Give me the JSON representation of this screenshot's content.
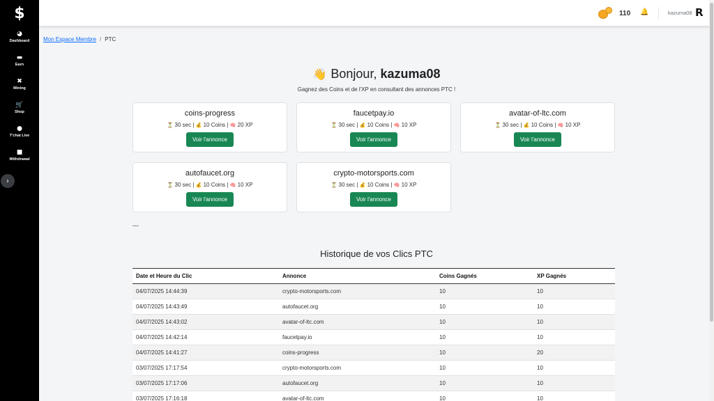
{
  "sidebar": {
    "brand_icon": "dollar-icon",
    "items": [
      {
        "label": "Dashboard",
        "icon": "dashboard-icon",
        "glyph": "◕"
      },
      {
        "label": "Earn",
        "icon": "money-icon",
        "glyph": "▬"
      },
      {
        "label": "Mining",
        "icon": "tools-icon",
        "glyph": "✖"
      },
      {
        "label": "Shop",
        "icon": "cart-icon",
        "glyph": "🛒"
      },
      {
        "label": "T'chat Live",
        "icon": "chat-icon",
        "glyph": "●"
      },
      {
        "label": "Withdrawal",
        "icon": "wallet-icon",
        "glyph": "■"
      }
    ],
    "toggle_icon": "chevron-right-icon"
  },
  "topbar": {
    "coin_count": "110",
    "username": "kazuma08",
    "logo_letter": "R"
  },
  "breadcrumb": {
    "home": "Mon Espace Membre",
    "separator": "/",
    "current": "PTC"
  },
  "greeting": {
    "hello": "Bonjour,",
    "user": "kazuma08",
    "subtitle": "Gagnez des Coins et de l'XP en consultant des annonces PTC !"
  },
  "ads": [
    {
      "title": "coins-progress",
      "time": "30 sec",
      "coins": "10 Coins",
      "xp": "20 XP",
      "button": "Voir l'annonce"
    },
    {
      "title": "faucetpay.io",
      "time": "30 sec",
      "coins": "10 Coins",
      "xp": "10 XP",
      "button": "Voir l'annonce"
    },
    {
      "title": "avatar-of-ltc.com",
      "time": "30 sec",
      "coins": "10 Coins",
      "xp": "10 XP",
      "button": "Voir l'annonce"
    },
    {
      "title": "autofaucet.org",
      "time": "30 sec",
      "coins": "10 Coins",
      "xp": "10 XP",
      "button": "Voir l'annonce"
    },
    {
      "title": "crypto-motorsports.com",
      "time": "30 sec",
      "coins": "10 Coins",
      "xp": "10 XP",
      "button": "Voir l'annonce"
    }
  ],
  "separator_text": "---",
  "history": {
    "title": "Historique de vos Clics PTC",
    "columns": [
      "Date et Heure du Clic",
      "Annonce",
      "Coins Gagnés",
      "XP Gagnés"
    ],
    "rows": [
      [
        "04/07/2025 14:44:39",
        "crypto-motorsports.com",
        "10",
        "10"
      ],
      [
        "04/07/2025 14:43:49",
        "autofaucet.org",
        "10",
        "10"
      ],
      [
        "04/07/2025 14:43:02",
        "avatar-of-ltc.com",
        "10",
        "10"
      ],
      [
        "04/07/2025 14:42:14",
        "faucetpay.io",
        "10",
        "10"
      ],
      [
        "04/07/2025 14:41:27",
        "coins-progress",
        "10",
        "20"
      ],
      [
        "03/07/2025 17:17:54",
        "crypto-motorsports.com",
        "10",
        "10"
      ],
      [
        "03/07/2025 17:17:06",
        "autofaucet.org",
        "10",
        "10"
      ],
      [
        "03/07/2025 17:16:18",
        "avatar-of-ltc.com",
        "10",
        "10"
      ]
    ]
  },
  "colors": {
    "sidebar_bg": "#000000",
    "button_green": "#198754",
    "link_blue": "#0d6efd"
  }
}
